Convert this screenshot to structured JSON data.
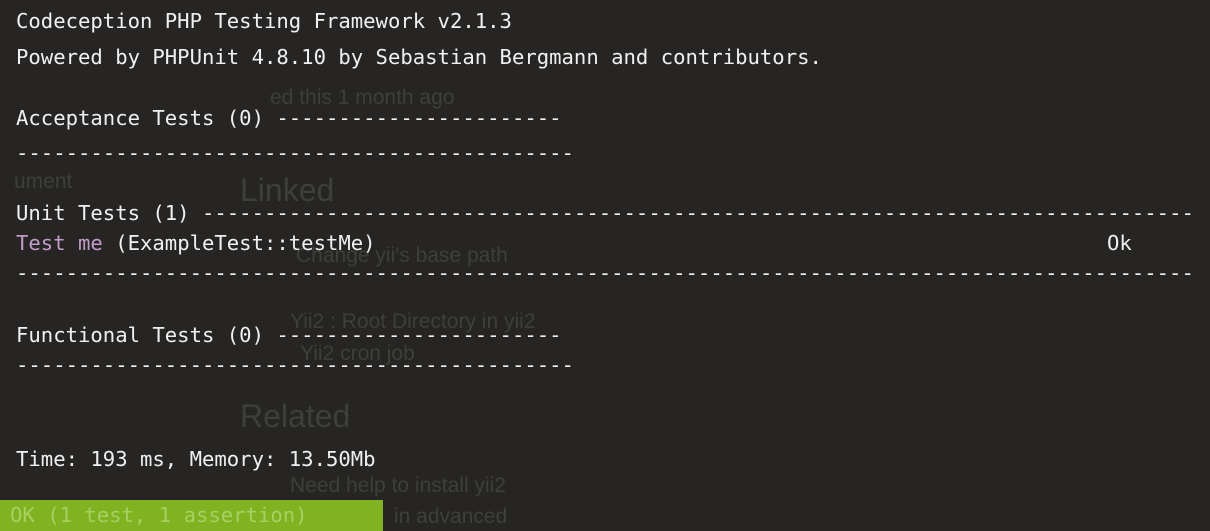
{
  "terminal": {
    "header_line1": "Codeception PHP Testing Framework v2.1.3",
    "header_line2": "Powered by PHPUnit 4.8.10 by Sebastian Bergmann and contributors.",
    "acceptance": {
      "title": "Acceptance Tests (0) ",
      "title_rule": "-----------------------",
      "rule": "---------------------------------------------"
    },
    "unit": {
      "title": "Unit Tests (1) ",
      "title_rule": "------------------------------------------------------------------------------------------",
      "test": {
        "name": "Test me",
        "detail": " (ExampleTest::testMe)",
        "status": "Ok"
      },
      "rule": "-------------------------------------------------------------------------------------------------------------"
    },
    "functional": {
      "title": "Functional Tests (0) ",
      "title_rule": "-----------------------",
      "rule": "---------------------------------------------"
    },
    "time_line": "Time: 193 ms, Memory: 13.50Mb",
    "result": "OK (1 test, 1 assertion)"
  },
  "background_ghost": {
    "t1": "ed this 1 month ago",
    "t2": "ument",
    "t3": "Linked",
    "t4": "Change yii's base path",
    "t5": "Yii2 : Root Directory in yii2",
    "t6": "Yii2 cron job",
    "t7": "Related",
    "t8": "Need help to install yii2",
    "t9": "in advanced"
  },
  "colors": {
    "background": "#262523",
    "text": "#f0f0f0",
    "test_name": "#c29bc9",
    "ok_bar": "#7fb321"
  }
}
